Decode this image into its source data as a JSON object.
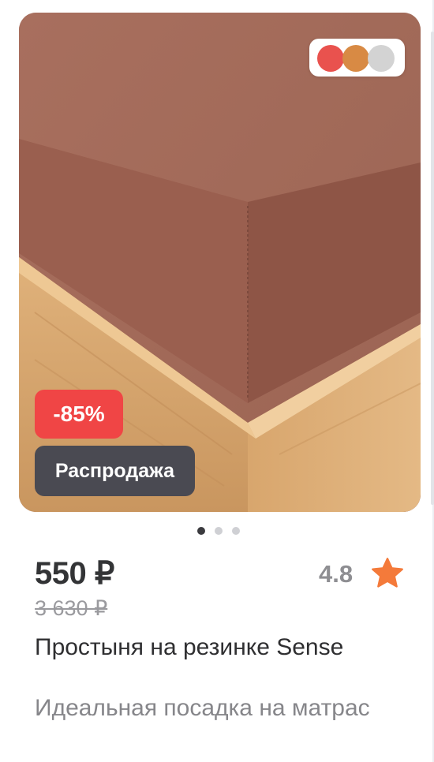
{
  "product": {
    "badges": {
      "discount": "-85%",
      "sale": "Распродажа"
    },
    "color_swatches": [
      {
        "name": "red",
        "hex": "#e9524e"
      },
      {
        "name": "orange",
        "hex": "#d88a44"
      },
      {
        "name": "light-gray",
        "hex": "#d3d3d3"
      }
    ],
    "gallery": {
      "image_count": 3,
      "active_index": 0
    },
    "price": "550 ₽",
    "old_price": "3 630 ₽",
    "rating": "4.8",
    "title": "Простыня на резинке Sense",
    "subtitle": "Идеальная посадка на матрас"
  },
  "colors": {
    "discount_bg": "#f04545",
    "sale_bg": "#4a4a52",
    "star": "#f47a3a",
    "sheet": "#a6705f",
    "wood": "#d9aa72"
  },
  "icons": {
    "rating": "star-icon"
  }
}
